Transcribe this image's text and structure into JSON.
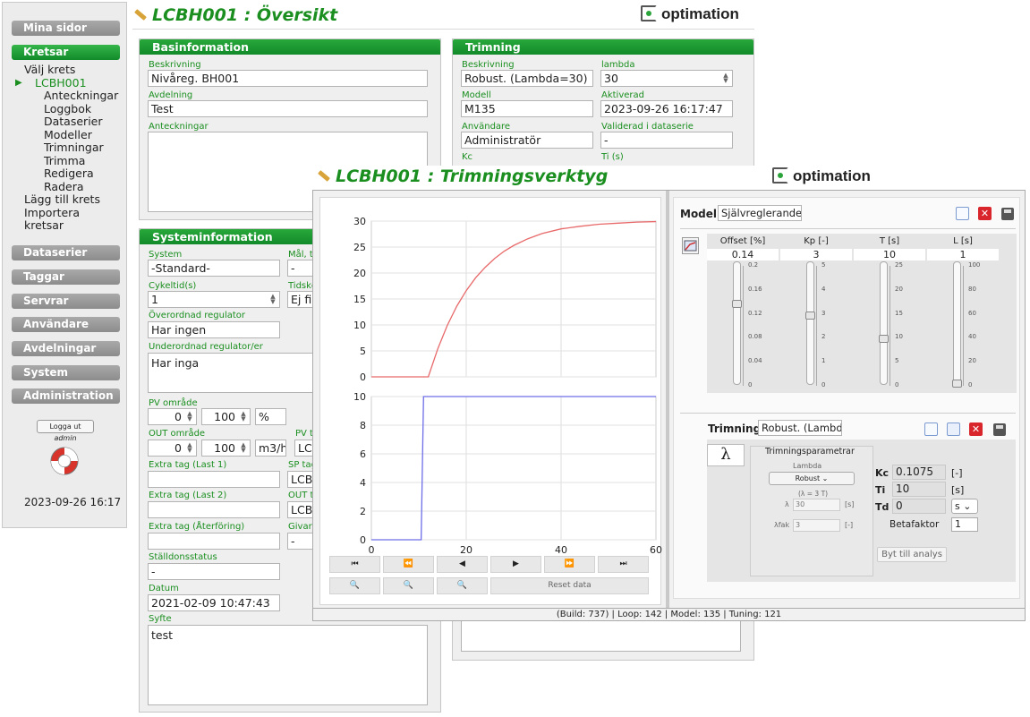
{
  "sidebar": {
    "top_button": "Mina sidor",
    "section": "Kretsar",
    "items": [
      "Välj krets",
      "LCBH001",
      "Anteckningar",
      "Loggbok",
      "Dataserier",
      "Modeller",
      "Trimningar",
      "Trimma",
      "Redigera",
      "Radera",
      "Lägg till krets",
      "Importera",
      "kretsar"
    ],
    "buttons": [
      "Dataserier",
      "Taggar",
      "Servrar",
      "Användare",
      "Avdelningar",
      "System",
      "Administration"
    ],
    "logout_prefix": "Logga ut",
    "logout_user": "admin",
    "datetime": "2023-09-26 16:17"
  },
  "overview": {
    "title": "LCBH001 : Översikt",
    "logo": "optimation",
    "basinfo": {
      "header": "Basinformation",
      "beskrivning_label": "Beskrivning",
      "beskrivning": "Nivåreg. BH001",
      "avdelning_label": "Avdelning",
      "avdelning": "Test",
      "anteckningar_label": "Anteckningar"
    },
    "trimning": {
      "header": "Trimning",
      "beskrivning_label": "Beskrivning",
      "beskrivning": "Robust. (Lambda=30)",
      "lambda_label": "lambda",
      "lambda": "30",
      "modell_label": "Modell",
      "modell": "M135",
      "aktiverad_label": "Aktiverad",
      "aktiverad": "2023-09-26 16:17:47",
      "anvandare_label": "Användare",
      "anvandare": "Administratör",
      "validerad_label": "Validerad i dataserie",
      "validerad": "-",
      "kc_label": "Kc",
      "ti_label": "Ti (s)"
    },
    "sysinfo": {
      "header": "Systeminformation",
      "system_label": "System",
      "system": "-Standard-",
      "mal_label": "Mål, tr",
      "mal": "-",
      "cykeltid_label": "Cykeltid(s)",
      "cykeltid": "1",
      "tidskc_label": "Tidskc",
      "tidskc": "Ej fil",
      "overordnad_label": "Överordnad regulator",
      "overordnad": "Har ingen",
      "underordnad_label": "Underordnad regulator/er",
      "underordnad": "Har inga",
      "pv_omrade_label": "PV område",
      "pv_min": "0",
      "pv_max": "100",
      "pv_unit": "%",
      "out_omrade_label": "OUT område",
      "out_min": "0",
      "out_max": "100",
      "out_unit": "m3/h",
      "pv_t_label": "PV ta",
      "pv_t": "LCI",
      "extra1_label": "Extra tag (Last 1)",
      "sp_tag_label": "SP tag",
      "sp_tag": "LCB",
      "extra2_label": "Extra tag (Last 2)",
      "out_t_label": "OUT t",
      "out_t": "LCB",
      "extra3_label": "Extra tag (Återföring)",
      "givare_label": "Givars",
      "givare": "-",
      "stalldon_label": "Ställdonsstatus",
      "stalldon": "-",
      "datum_label": "Datum",
      "datum": "2021-02-09 10:47:43",
      "syfte_label": "Syfte",
      "syfte": "test"
    }
  },
  "tool": {
    "title": "LCBH001 : Trimningsverktyg",
    "logo": "optimation",
    "status": "(Build: 737) | Loop: 142 | Model: 135 | Tuning: 121",
    "reset_label": "Reset data",
    "playback": [
      "⏮",
      "⏪",
      "◀",
      "▶",
      "⏩",
      "⏭"
    ],
    "modell_label": "Modell",
    "modell_value": "Självreglerande I",
    "sliders": [
      {
        "name": "Offset [%]",
        "value": "0.14",
        "ticks": [
          "0.2",
          "0.16",
          "0.12",
          "0.08",
          "0.04",
          "0"
        ]
      },
      {
        "name": "Kp [-]",
        "value": "3",
        "ticks": [
          "5",
          "4",
          "3",
          "2",
          "1",
          "0"
        ]
      },
      {
        "name": "T [s]",
        "value": "10",
        "ticks": [
          "25",
          "20",
          "15",
          "10",
          "5",
          "0"
        ]
      },
      {
        "name": "L [s]",
        "value": "1",
        "ticks": [
          "100",
          "80",
          "60",
          "40",
          "20",
          "0"
        ]
      }
    ],
    "trimning_label": "Trimning",
    "trimning_value": "Robust. (Lambda",
    "lambda_symbol": "λ",
    "params_title": "Trimningsparametrar",
    "method_label": "Lambda",
    "method_value": "Robust",
    "lambda_hint": "(λ = 3 T)",
    "lambda_row_label": "λ",
    "lambda_row_value": "30",
    "lambda_row_unit": "[s]",
    "lfak_label": "λfak",
    "lfak_value": "3",
    "lfak_unit": "[-]",
    "kc_label": "Kc",
    "kc_value": "0.1075",
    "kc_unit": "[-]",
    "ti_label": "Ti",
    "ti_value": "10",
    "ti_unit": "[s]",
    "td_label": "Td",
    "td_value": "0",
    "td_unit": "s",
    "beta_label": "Betafaktor",
    "beta_value": "1",
    "analys_button": "Byt till analys"
  },
  "chart_data": [
    {
      "type": "line",
      "series": [
        {
          "color": "#e8696a",
          "x": [
            0,
            11,
            12,
            14,
            16,
            18,
            20,
            22,
            24,
            26,
            28,
            30,
            33,
            36,
            40,
            44,
            48,
            52,
            56,
            60
          ],
          "y": [
            0,
            0,
            0,
            5.4,
            9.9,
            13.6,
            16.6,
            19.1,
            21.1,
            22.8,
            24.2,
            25.3,
            26.6,
            27.6,
            28.5,
            29.0,
            29.4,
            29.6,
            29.8,
            29.9
          ]
        }
      ],
      "xlim": [
        0,
        60
      ],
      "ylim": [
        0,
        30
      ],
      "yticks": [
        "0",
        "5",
        "10",
        "15",
        "20",
        "25",
        "30"
      ],
      "grid": true
    },
    {
      "type": "line",
      "series": [
        {
          "color": "#6d6de8",
          "x": [
            0,
            10.5,
            11,
            60
          ],
          "y": [
            0,
            0,
            10,
            10
          ]
        }
      ],
      "xlim": [
        0,
        60
      ],
      "ylim": [
        0,
        10
      ],
      "xticks": [
        "0",
        "20",
        "40",
        "60"
      ],
      "yticks": [
        "0",
        "2",
        "4",
        "6",
        "8",
        "10"
      ],
      "grid": true
    }
  ]
}
